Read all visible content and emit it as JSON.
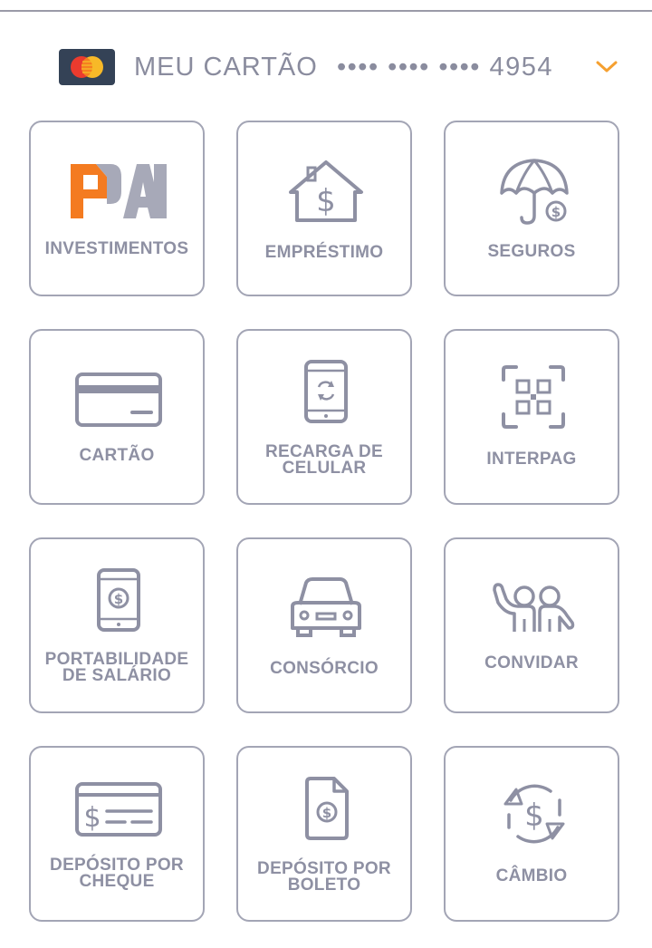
{
  "card": {
    "name": "MEU CARTÃO",
    "number": "•••• •••• •••• 4954",
    "logo": "mastercard-logo",
    "accent_color": "#f5a030"
  },
  "menu": {
    "items": [
      {
        "label": "INVESTIMENTOS",
        "icon": "pai-logo-icon"
      },
      {
        "label": "EMPRÉSTIMO",
        "icon": "house-dollar-icon"
      },
      {
        "label": "SEGUROS",
        "icon": "umbrella-dollar-icon"
      },
      {
        "label": "CARTÃO",
        "icon": "credit-card-icon"
      },
      {
        "label": "RECARGA DE\nCELULAR",
        "icon": "phone-refresh-icon"
      },
      {
        "label": "INTERPAG",
        "icon": "qr-code-icon"
      },
      {
        "label": "PORTABILIDADE\nDE SALÁRIO",
        "icon": "phone-dollar-icon"
      },
      {
        "label": "CONSÓRCIO",
        "icon": "car-icon"
      },
      {
        "label": "CONVIDAR",
        "icon": "friends-icon"
      },
      {
        "label": "DEPÓSITO POR\nCHEQUE",
        "icon": "cheque-icon"
      },
      {
        "label": "DEPÓSITO POR\nBOLETO",
        "icon": "boleto-document-icon"
      },
      {
        "label": "CÂMBIO",
        "icon": "exchange-icon"
      }
    ]
  }
}
